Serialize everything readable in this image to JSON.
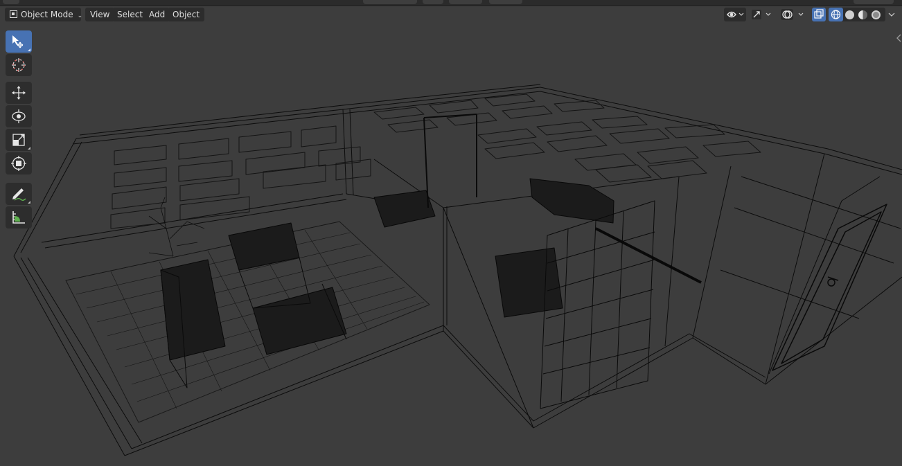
{
  "header": {
    "mode_label": "Object Mode",
    "menu": [
      "View",
      "Select",
      "Add",
      "Object"
    ]
  },
  "toolbar": {
    "tools": [
      "select-box",
      "cursor",
      "move",
      "rotate",
      "scale",
      "transform",
      "annotate",
      "measure"
    ],
    "active_tool": "select-box"
  },
  "viewport": {
    "shading_mode": "wireframe",
    "xray": true
  },
  "colors": {
    "viewport_bg": "#3d3d3d",
    "accent": "#4772b3",
    "button_bg": "#2c2c2c",
    "wire": "#0c0c0c"
  }
}
